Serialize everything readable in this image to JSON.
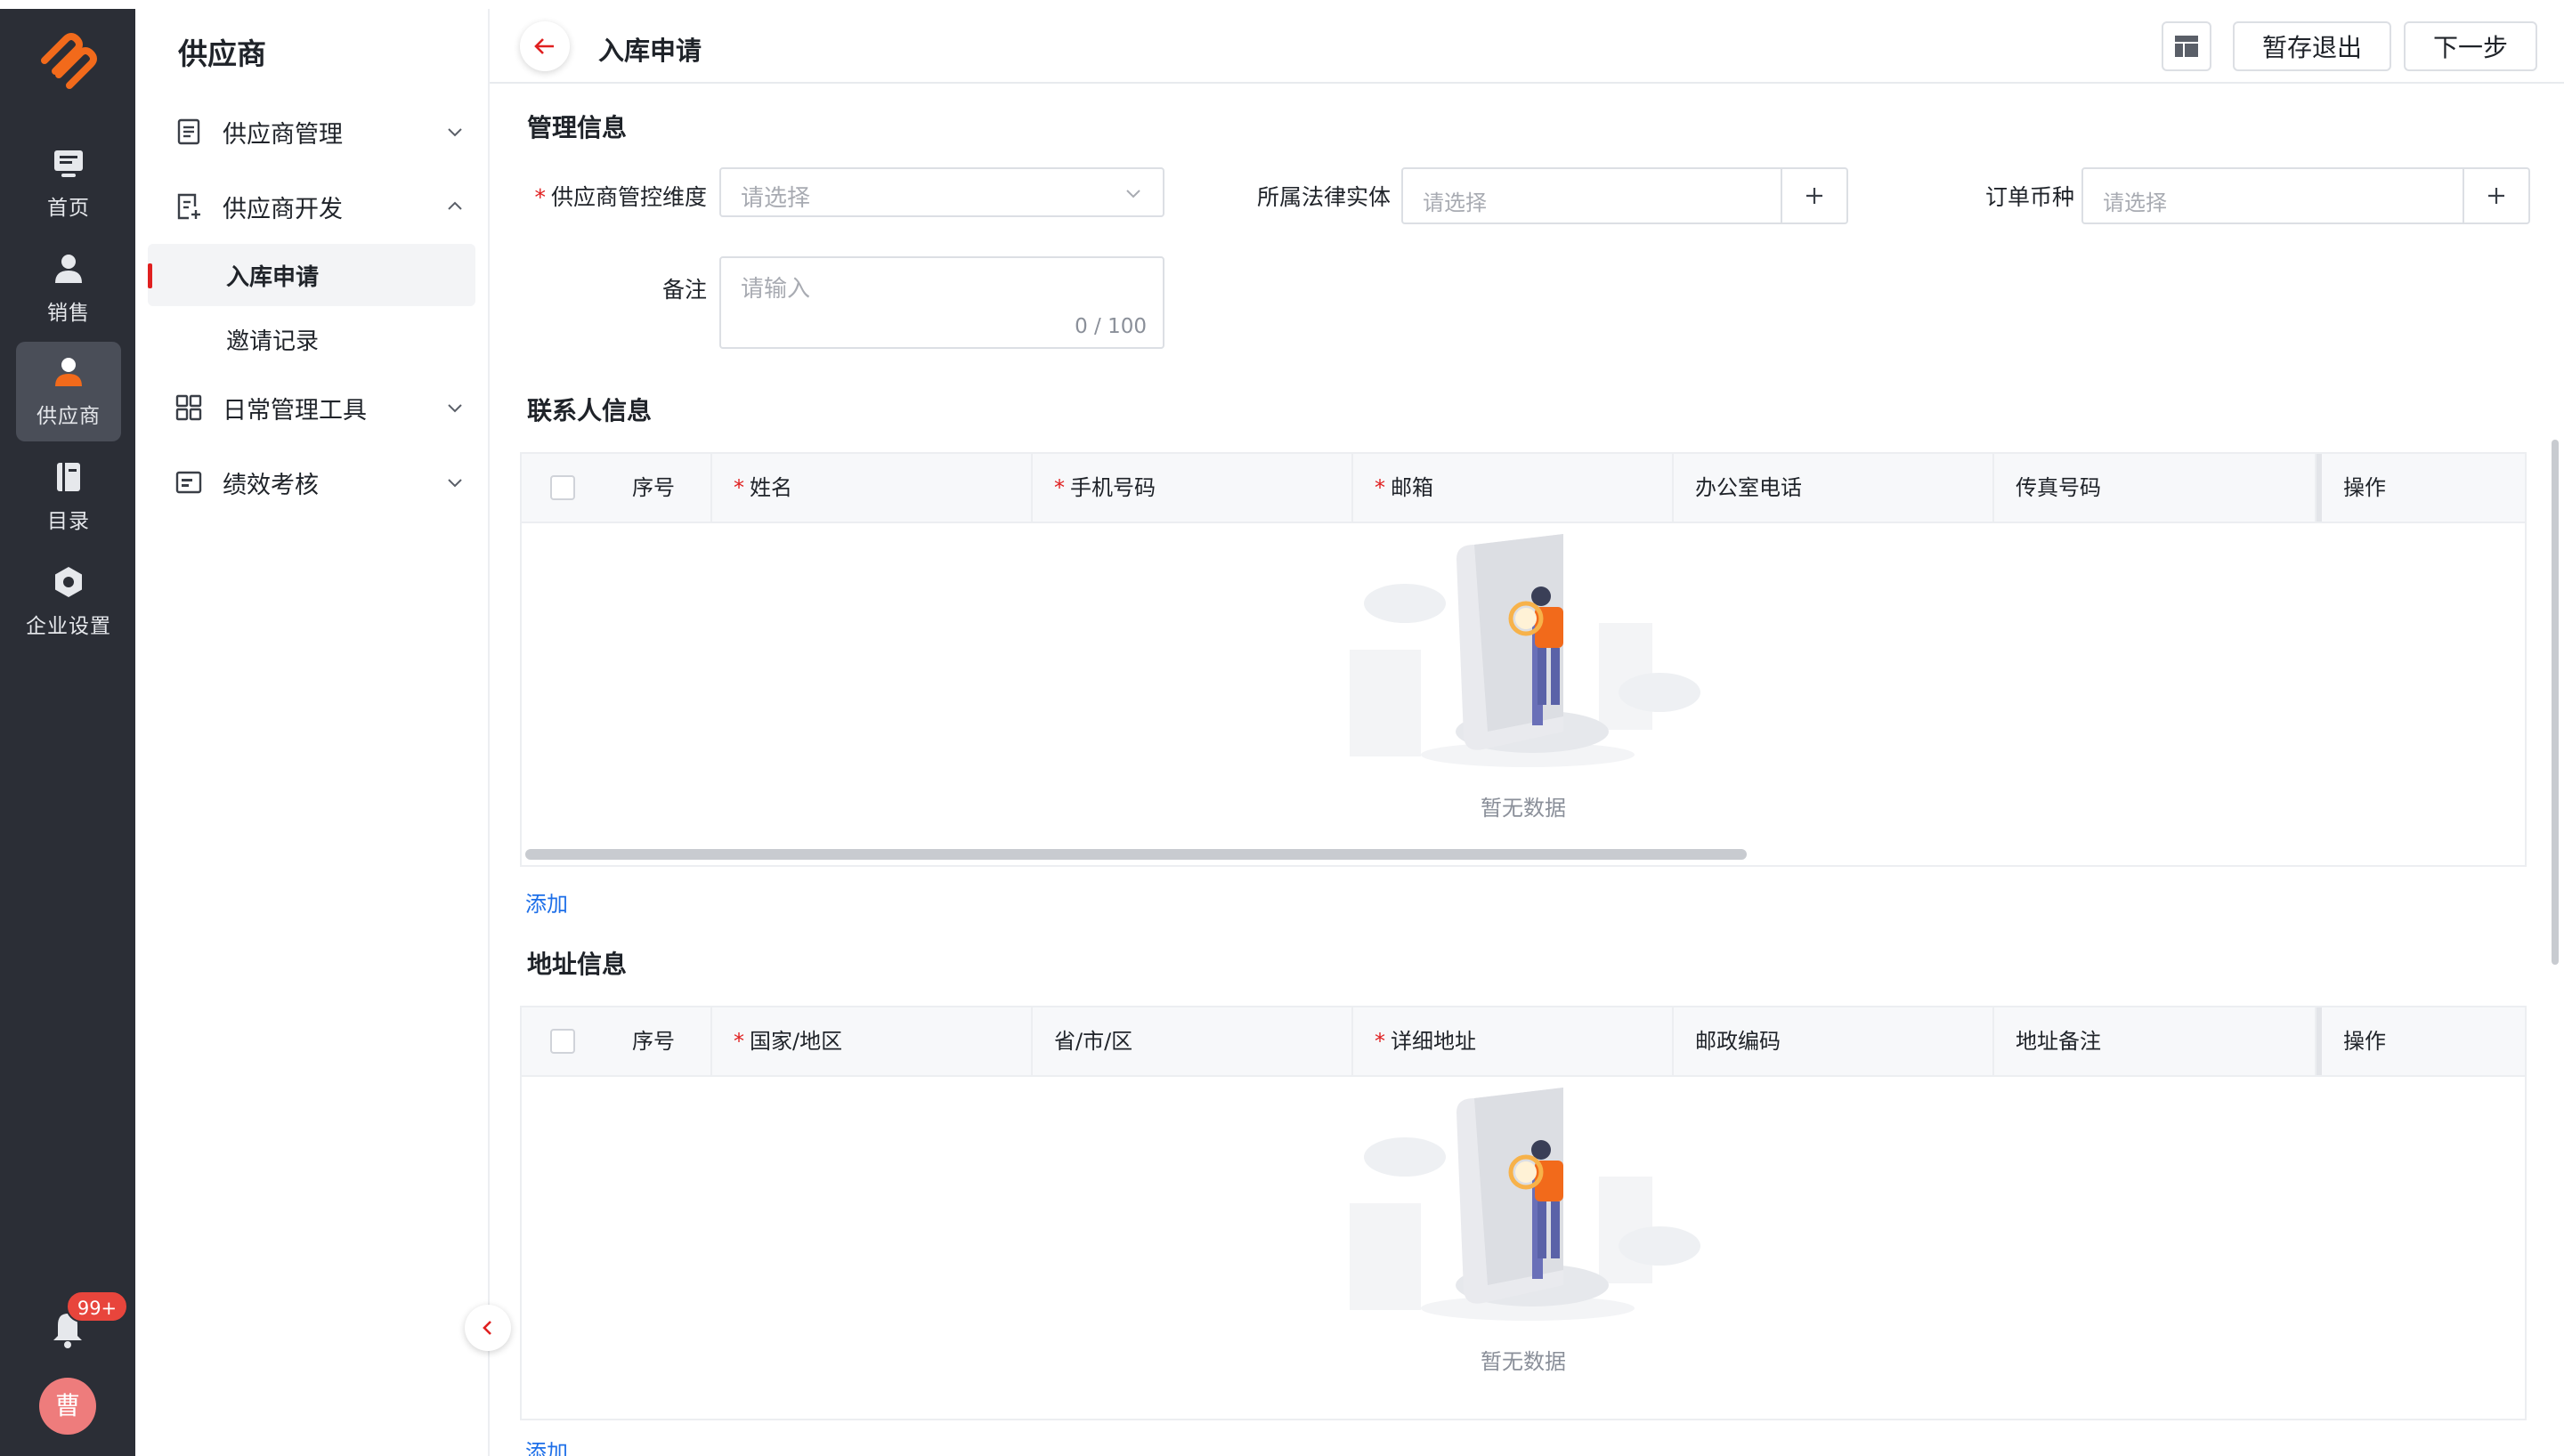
{
  "rail": {
    "items": [
      {
        "label": "首页",
        "icon": "monitor-icon"
      },
      {
        "label": "销售",
        "icon": "user-icon"
      },
      {
        "label": "供应商",
        "icon": "user-orange-icon"
      },
      {
        "label": "目录",
        "icon": "book-icon"
      },
      {
        "label": "企业设置",
        "icon": "gear-icon"
      }
    ],
    "badge": "99+",
    "avatar_text": "曹"
  },
  "subnav": {
    "title": "供应商",
    "groups": [
      {
        "label": "供应商管理"
      },
      {
        "label": "供应商开发"
      },
      {
        "label": "日常管理工具"
      },
      {
        "label": "绩效考核"
      }
    ],
    "subitems": [
      {
        "label": "入库申请"
      },
      {
        "label": "邀请记录"
      }
    ]
  },
  "header": {
    "title": "入库申请",
    "save_label": "暂存退出",
    "next_label": "下一步"
  },
  "management": {
    "section_title": "管理信息",
    "control_label": "供应商管控维度",
    "control_placeholder": "请选择",
    "legal_label": "所属法律实体",
    "legal_placeholder": "请选择",
    "currency_label": "订单币种",
    "currency_placeholder": "请选择",
    "remark_label": "备注",
    "remark_placeholder": "请输入",
    "remark_count": "0 / 100"
  },
  "contacts": {
    "section_title": "联系人信息",
    "columns": [
      "序号",
      "姓名",
      "手机号码",
      "邮箱",
      "办公室电话",
      "传真号码",
      "操作"
    ],
    "empty_text": "暂无数据",
    "add_label": "添加"
  },
  "addresses": {
    "section_title": "地址信息",
    "columns": [
      "序号",
      "国家/地区",
      "省/市/区",
      "详细地址",
      "邮政编码",
      "地址备注",
      "操作"
    ],
    "empty_text": "暂无数据",
    "add_label": "添加"
  },
  "colors": {
    "rail_bg": "#2b2e36",
    "accent_red": "#e02020",
    "link_blue": "#1e6fe8",
    "logo_orange": "#f26a1b"
  }
}
